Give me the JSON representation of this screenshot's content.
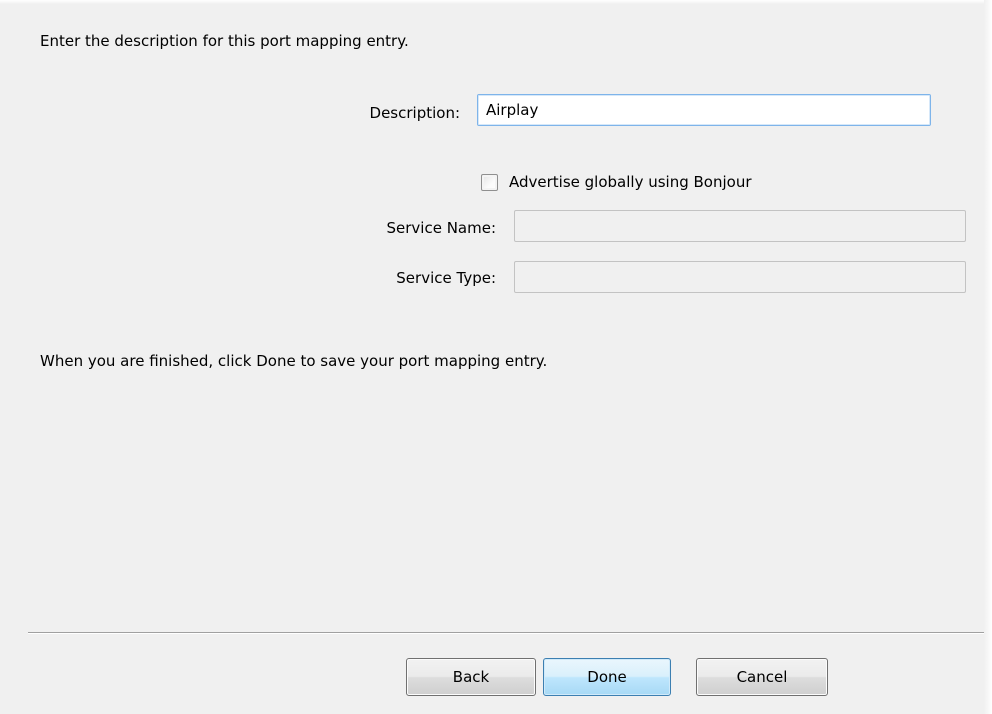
{
  "dialog": {
    "intro_text": "Enter the description for this port mapping entry.",
    "finish_text": "When you are finished, click Done to save your port mapping entry."
  },
  "form": {
    "description_label": "Description:",
    "description_value": "Airplay",
    "advertise_label": "Advertise globally using Bonjour",
    "advertise_checked": false,
    "service_name_label": "Service Name:",
    "service_name_value": "",
    "service_type_label": "Service Type:",
    "service_type_value": ""
  },
  "buttons": {
    "back_label": "Back",
    "done_label": "Done",
    "cancel_label": "Cancel"
  }
}
